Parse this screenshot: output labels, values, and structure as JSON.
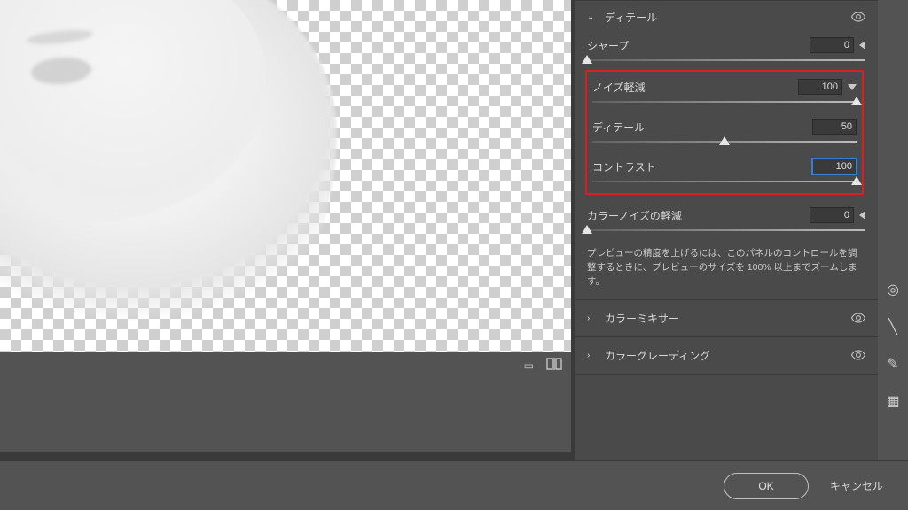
{
  "panel": {
    "detail": {
      "title": "ディテール",
      "sliders": {
        "sharpen": {
          "label": "シャープ",
          "value": "0",
          "pos": 0
        },
        "noise": {
          "label": "ノイズ軽減",
          "value": "100",
          "pos": 100
        },
        "detail": {
          "label": "ディテール",
          "value": "50",
          "pos": 50
        },
        "contrast": {
          "label": "コントラスト",
          "value": "100",
          "pos": 100
        },
        "colorNoise": {
          "label": "カラーノイズの軽減",
          "value": "0",
          "pos": 0
        }
      },
      "hint": "プレビューの精度を上げるには、このパネルのコントロールを調整するときに、プレビューのサイズを 100% 以上までズームします。"
    },
    "colorMixer": {
      "title": "カラーミキサー"
    },
    "colorGrading": {
      "title": "カラーグレーディング"
    }
  },
  "footer": {
    "ok": "OK",
    "cancel": "キャンセル"
  }
}
